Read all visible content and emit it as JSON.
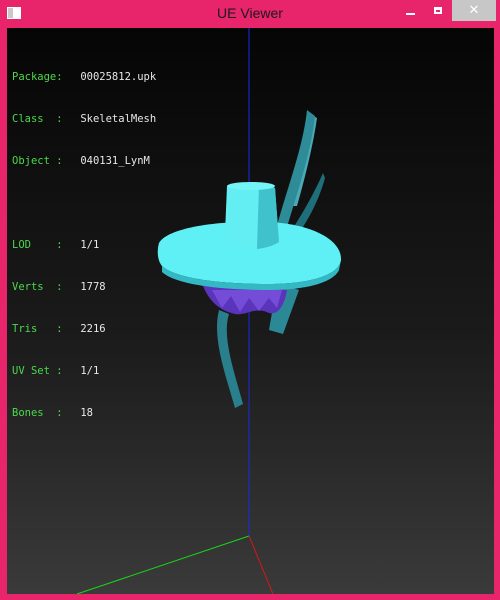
{
  "window": {
    "title": "UE Viewer"
  },
  "info": {
    "package": {
      "label": "Package:",
      "value": "00025812.upk"
    },
    "class": {
      "label": "Class  :",
      "value": "SkeletalMesh"
    },
    "object": {
      "label": "Object :",
      "value": "040131_LynM"
    },
    "lod": {
      "label": "LOD    :",
      "value": "1/1"
    },
    "verts": {
      "label": "Verts  :",
      "value": "1778"
    },
    "tris": {
      "label": "Tris   :",
      "value": "2216"
    },
    "uvset": {
      "label": "UV Set :",
      "value": "1/1"
    },
    "bones": {
      "label": "Bones  :",
      "value": "18"
    }
  },
  "colors": {
    "frame": "#e8246a",
    "label": "#4cd84c",
    "value": "#e8e8e8",
    "hat": "#5ef0f4",
    "hat_shade": "#2fa6b2",
    "hair": "#6a3cc8",
    "axis_x": "#d01010",
    "axis_y": "#10d010",
    "axis_z": "#1020d0"
  }
}
